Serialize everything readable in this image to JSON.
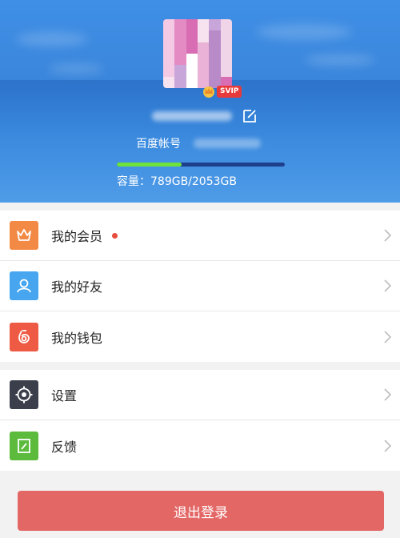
{
  "profile": {
    "badge": "SVIP",
    "account_label": "百度帐号",
    "capacity_text": "容量：789GB/2053GB",
    "storage_used_fraction": 0.384
  },
  "menu_primary": [
    {
      "label": "我的会员",
      "icon": "crown-icon",
      "color": "#f28a45",
      "new_dot": true
    },
    {
      "label": "我的好友",
      "icon": "person-icon",
      "color": "#47a6ef",
      "new_dot": false
    },
    {
      "label": "我的钱包",
      "icon": "wallet-icon",
      "color": "#ef5a45",
      "new_dot": false
    }
  ],
  "menu_secondary": [
    {
      "label": "设置",
      "icon": "gear-icon",
      "color": "#3b3f4c"
    },
    {
      "label": "反馈",
      "icon": "feedback-icon",
      "color": "#5cba3c"
    }
  ],
  "logout_label": "退出登录",
  "colors": {
    "header_blue": "#3a86dc",
    "progress_fill": "#6ee23a",
    "logout": "#e36765",
    "badge_red": "#e83a3a"
  }
}
